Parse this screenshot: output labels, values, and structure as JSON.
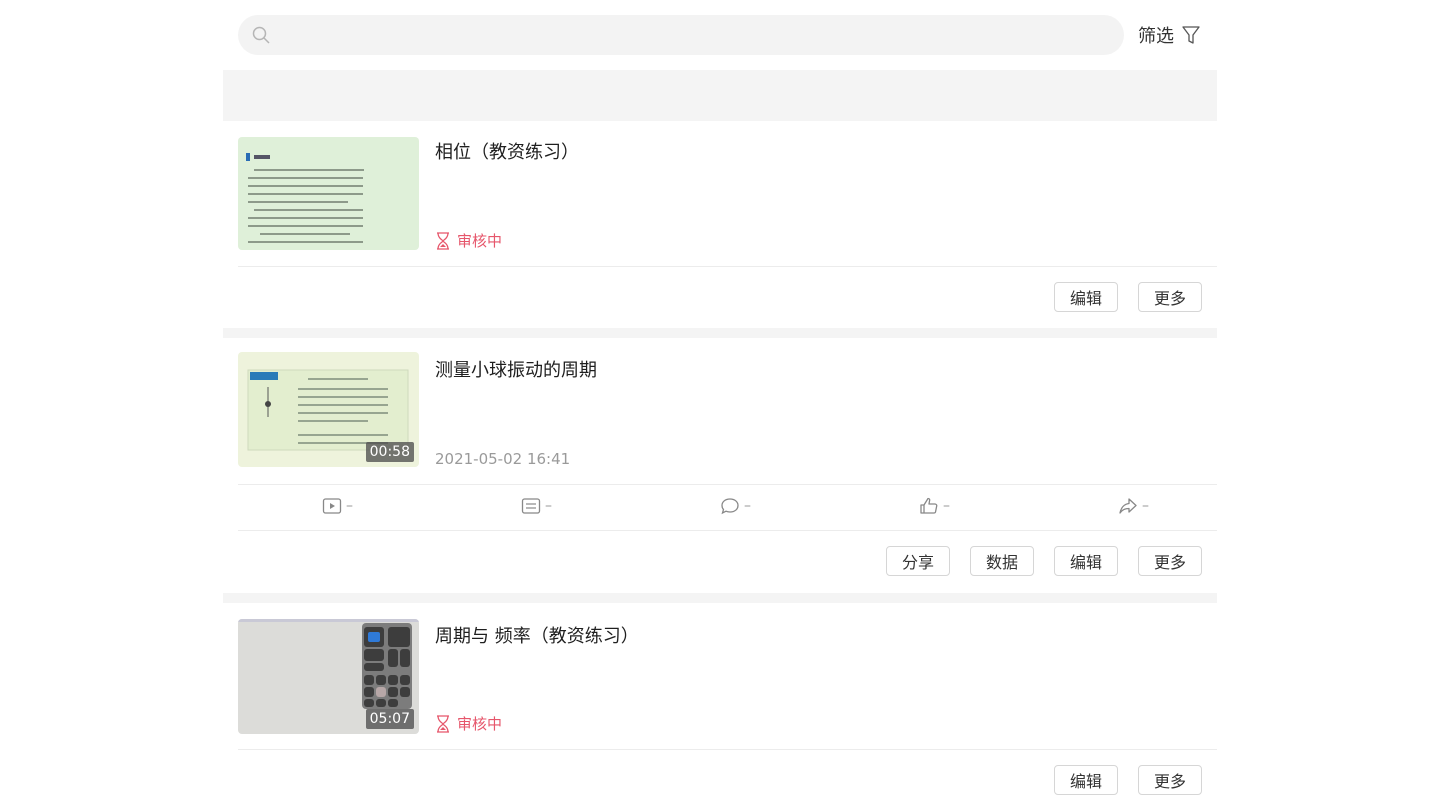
{
  "search": {
    "placeholder": ""
  },
  "filter": {
    "label": "筛选"
  },
  "colors": {
    "status_pending": "#e6566b",
    "muted": "#9a9a9a"
  },
  "items": [
    {
      "title": "相位（教资练习）",
      "status": "审核中",
      "actions": [
        "编辑",
        "更多"
      ]
    },
    {
      "title": "测量小球振动的周期",
      "duration": "00:58",
      "date": "2021-05-02 16:41",
      "stats": [
        {
          "icon": "play-icon",
          "value": "–"
        },
        {
          "icon": "list-icon",
          "value": "–"
        },
        {
          "icon": "comment-icon",
          "value": "–"
        },
        {
          "icon": "thumbs-up-icon",
          "value": "–"
        },
        {
          "icon": "share-icon",
          "value": "–"
        }
      ],
      "actions": [
        "分享",
        "数据",
        "编辑",
        "更多"
      ]
    },
    {
      "title": "周期与 频率（教资练习）",
      "duration": "05:07",
      "status": "审核中",
      "actions": [
        "编辑",
        "更多"
      ]
    }
  ]
}
